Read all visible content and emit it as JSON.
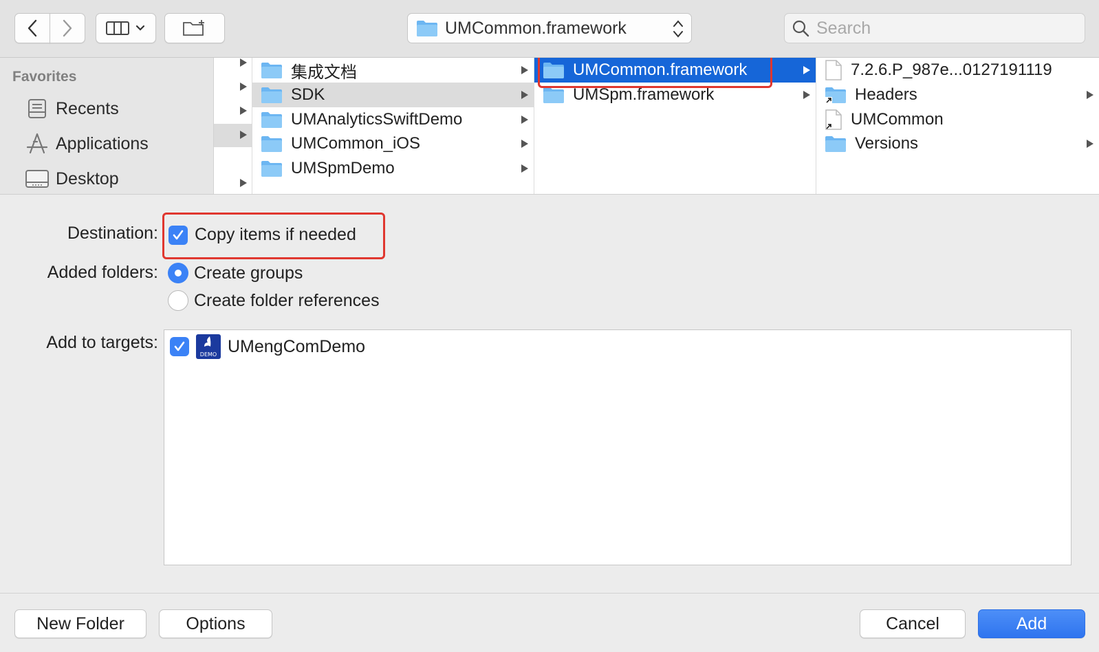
{
  "toolbar": {
    "path_selector": "UMCommon.framework",
    "search_placeholder": "Search"
  },
  "sidebar": {
    "heading": "Favorites",
    "items": [
      {
        "label": "Recents",
        "icon": "recents-icon"
      },
      {
        "label": "Applications",
        "icon": "applications-icon"
      },
      {
        "label": "Desktop",
        "icon": "desktop-icon"
      }
    ]
  },
  "columns": {
    "col1": [
      "集成文档",
      "SDK",
      "UMAnalyticsSwiftDemo",
      "UMCommon_iOS",
      "UMSpmDemo"
    ],
    "col2": [
      "UMCommon.framework",
      "UMSpm.framework"
    ],
    "col3": [
      "7.2.6.P_987e...0127191119",
      "Headers",
      "UMCommon",
      "Versions"
    ]
  },
  "options": {
    "destination_label": "Destination:",
    "copy_items": "Copy items if needed",
    "added_folders_label": "Added folders:",
    "create_groups": "Create groups",
    "create_folder_references": "Create folder references",
    "add_to_targets_label": "Add to targets:",
    "target_name": "UMengComDemo",
    "target_icon_text": "DEMO"
  },
  "buttons": {
    "new_folder": "New Folder",
    "options": "Options",
    "cancel": "Cancel",
    "add": "Add"
  },
  "colors": {
    "accent": "#3b82f6",
    "selection_blue": "#1666d8",
    "highlight_red": "#e0372f",
    "folder_blue": "#6cb6f2"
  }
}
